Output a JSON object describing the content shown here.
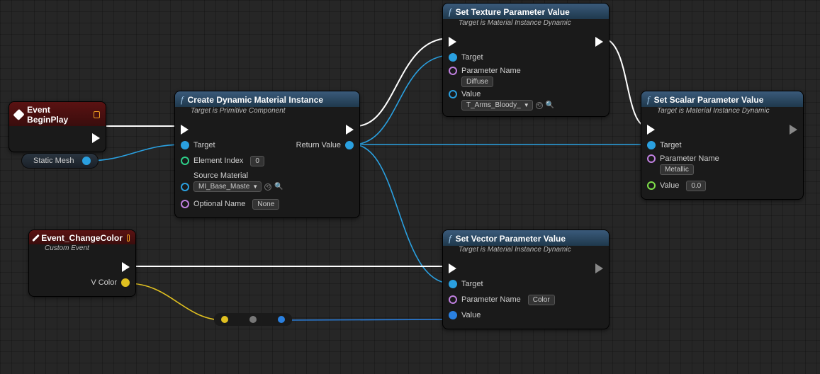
{
  "nodes": {
    "beginPlay": {
      "title": "Event BeginPlay"
    },
    "createDMI": {
      "title": "Create Dynamic Material Instance",
      "subtitle": "Target is Primitive Component",
      "pins": {
        "target": "Target",
        "elementIndex": "Element Index",
        "elementIndexVal": "0",
        "sourceMaterial": "Source Material",
        "sourceMaterialVal": "MI_Base_Maste",
        "optionalName": "Optional Name",
        "optionalNameVal": "None",
        "returnValue": "Return Value"
      }
    },
    "staticMesh": {
      "label": "Static Mesh"
    },
    "changeColor": {
      "title": "Event_ChangeColor",
      "subtitle": "Custom Event",
      "pins": {
        "vcolor": "V Color"
      }
    },
    "setTexture": {
      "title": "Set Texture Parameter Value",
      "subtitle": "Target is Material Instance Dynamic",
      "pins": {
        "target": "Target",
        "paramName": "Parameter Name",
        "paramNameVal": "Diffuse",
        "value": "Value",
        "valueVal": "T_Arms_Bloody_"
      }
    },
    "setScalar": {
      "title": "Set Scalar Parameter Value",
      "subtitle": "Target is Material Instance Dynamic",
      "pins": {
        "target": "Target",
        "paramName": "Parameter Name",
        "paramNameVal": "Metallic",
        "value": "Value",
        "valueVal": "0.0"
      }
    },
    "setVector": {
      "title": "Set Vector Parameter Value",
      "subtitle": "Target is Material Instance Dynamic",
      "pins": {
        "target": "Target",
        "paramName": "Parameter Name",
        "paramNameVal": "Color",
        "value": "Value"
      }
    }
  }
}
